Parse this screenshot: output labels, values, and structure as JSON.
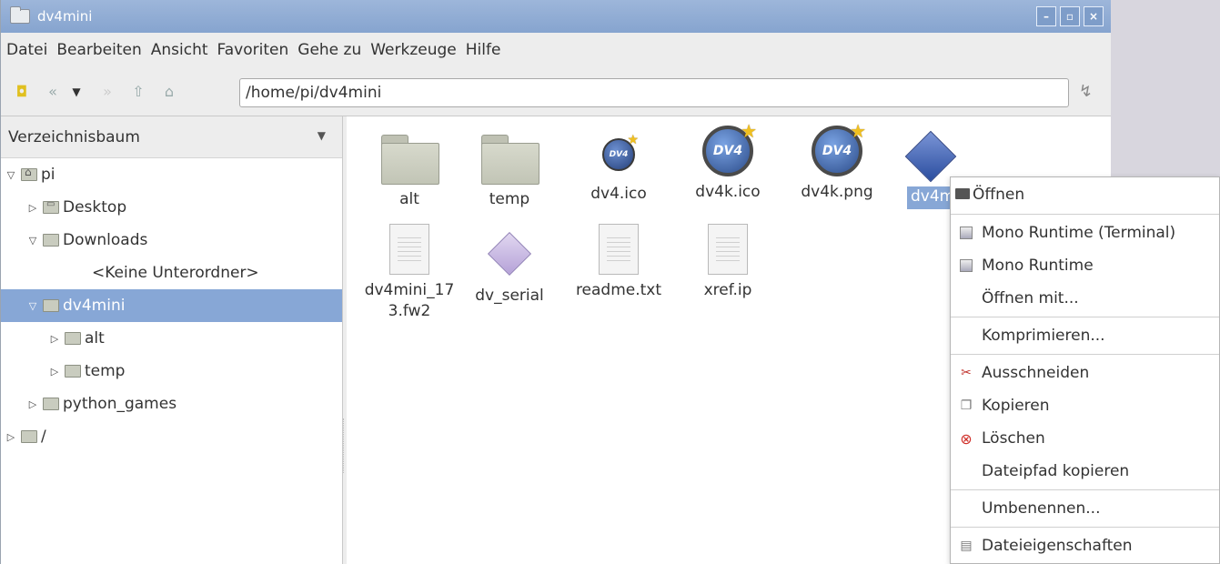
{
  "window": {
    "title": "dv4mini"
  },
  "menu": [
    "Datei",
    "Bearbeiten",
    "Ansicht",
    "Favoriten",
    "Gehe zu",
    "Werkzeuge",
    "Hilfe"
  ],
  "address": {
    "value": "/home/pi/dv4mini"
  },
  "sidebar": {
    "header": "Verzeichnisbaum",
    "tree": [
      {
        "label": "pi",
        "expanded": true
      },
      {
        "label": "Desktop"
      },
      {
        "label": "Downloads",
        "expanded": true
      },
      {
        "label": "<Keine Unterordner>"
      },
      {
        "label": "dv4mini",
        "selected": true,
        "expanded": true
      },
      {
        "label": "alt"
      },
      {
        "label": "temp"
      },
      {
        "label": "python_games"
      },
      {
        "label": "/"
      }
    ]
  },
  "files": [
    {
      "name": "alt",
      "icon": "folder-icon"
    },
    {
      "name": "temp",
      "icon": "folder-icon"
    },
    {
      "name": "dv4.ico",
      "icon": "dv4-small-icon"
    },
    {
      "name": "dv4k.ico",
      "icon": "dv4-big-icon"
    },
    {
      "name": "dv4k.png",
      "icon": "dv4-big-icon"
    },
    {
      "name": "dv4m",
      "icon": "diamond-icon",
      "selected": true
    },
    {
      "name": "dv4mini_173.fw2",
      "line1": "dv4mini_17",
      "line2": "3.fw2",
      "icon": "document-icon"
    },
    {
      "name": "dv_serial",
      "icon": "diamond-light-icon"
    },
    {
      "name": "readme.txt",
      "icon": "document-icon"
    },
    {
      "name": "xref.ip",
      "icon": "document-icon"
    }
  ],
  "context_menu": [
    {
      "label": "Öffnen",
      "icon": "folder-open-icon"
    },
    {
      "label": "Mono Runtime (Terminal)",
      "icon": "mono-icon"
    },
    {
      "label": "Mono Runtime",
      "icon": "mono-icon"
    },
    {
      "label": "Öffnen mit..."
    },
    {
      "label": "Komprimieren..."
    },
    {
      "label": "Ausschneiden",
      "icon": "scissors-icon"
    },
    {
      "label": "Kopieren",
      "icon": "copy-icon"
    },
    {
      "label": "Löschen",
      "icon": "delete-icon"
    },
    {
      "label": "Dateipfad kopieren"
    },
    {
      "label": "Umbenennen..."
    },
    {
      "label": "Dateieigenschaften",
      "icon": "properties-icon"
    }
  ],
  "colors": {
    "titlebar": "#86a4cf",
    "selection": "#87a7d6"
  }
}
